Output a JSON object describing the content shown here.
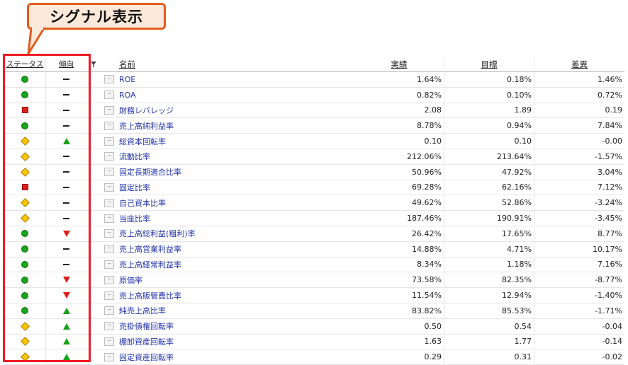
{
  "callout": {
    "label": "シグナル表示"
  },
  "headers": {
    "status": "ステータス",
    "trend": "傾向",
    "flag": "flag-filter-icon",
    "name": "名前",
    "actual": "実績",
    "target": "目標",
    "diff": "差異"
  },
  "colors": {
    "good": "#1aa61a",
    "bad": "#e0201c",
    "warn": "#ffc600",
    "highlight": "#ee1c24",
    "callout_border": "#e25b1e",
    "link": "#2233aa"
  },
  "rows": [
    {
      "status": "green-circle",
      "trend": "flat",
      "name": "ROE",
      "actual": "1.64%",
      "target": "0.18%",
      "diff": "1.46%"
    },
    {
      "status": "green-circle",
      "trend": "flat",
      "name": "ROA",
      "actual": "0.82%",
      "target": "0.10%",
      "diff": "0.72%"
    },
    {
      "status": "red-square",
      "trend": "flat",
      "name": "財務レバレッジ",
      "actual": "2.08",
      "target": "1.89",
      "diff": "0.19"
    },
    {
      "status": "green-circle",
      "trend": "flat",
      "name": "売上高純利益率",
      "actual": "8.78%",
      "target": "0.94%",
      "diff": "7.84%"
    },
    {
      "status": "yellow-diamond",
      "trend": "up",
      "name": "総資本回転率",
      "actual": "0.10",
      "target": "0.10",
      "diff": "-0.00"
    },
    {
      "status": "yellow-diamond",
      "trend": "flat",
      "name": "流動比率",
      "actual": "212.06%",
      "target": "213.64%",
      "diff": "-1.57%"
    },
    {
      "status": "yellow-diamond",
      "trend": "flat",
      "name": "固定長期適合比率",
      "actual": "50.96%",
      "target": "47.92%",
      "diff": "3.04%"
    },
    {
      "status": "red-square",
      "trend": "flat",
      "name": "固定比率",
      "actual": "69.28%",
      "target": "62.16%",
      "diff": "7.12%"
    },
    {
      "status": "yellow-diamond",
      "trend": "flat",
      "name": "自己資本比率",
      "actual": "49.62%",
      "target": "52.86%",
      "diff": "-3.24%"
    },
    {
      "status": "yellow-diamond",
      "trend": "flat",
      "name": "当座比率",
      "actual": "187.46%",
      "target": "190.91%",
      "diff": "-3.45%"
    },
    {
      "status": "green-circle",
      "trend": "down",
      "name": "売上高総利益(粗利)率",
      "actual": "26.42%",
      "target": "17.65%",
      "diff": "8.77%"
    },
    {
      "status": "green-circle",
      "trend": "flat",
      "name": "売上高営業利益率",
      "actual": "14.88%",
      "target": "4.71%",
      "diff": "10.17%"
    },
    {
      "status": "green-circle",
      "trend": "flat",
      "name": "売上高経常利益率",
      "actual": "8.34%",
      "target": "1.18%",
      "diff": "7.16%"
    },
    {
      "status": "green-circle",
      "trend": "down",
      "name": "原価率",
      "actual": "73.58%",
      "target": "82.35%",
      "diff": "-8.77%"
    },
    {
      "status": "green-circle",
      "trend": "down",
      "name": "売上高販管費比率",
      "actual": "11.54%",
      "target": "12.94%",
      "diff": "-1.40%"
    },
    {
      "status": "green-circle",
      "trend": "up",
      "name": "純売上高比率",
      "actual": "83.82%",
      "target": "85.53%",
      "diff": "-1.71%"
    },
    {
      "status": "yellow-diamond",
      "trend": "up",
      "name": "売掛債権回転率",
      "actual": "0.50",
      "target": "0.54",
      "diff": "-0.04"
    },
    {
      "status": "yellow-diamond",
      "trend": "up",
      "name": "棚卸資産回転率",
      "actual": "1.63",
      "target": "1.77",
      "diff": "-0.14"
    },
    {
      "status": "yellow-diamond",
      "trend": "up",
      "name": "固定資産回転率",
      "actual": "0.29",
      "target": "0.31",
      "diff": "-0.02"
    }
  ]
}
